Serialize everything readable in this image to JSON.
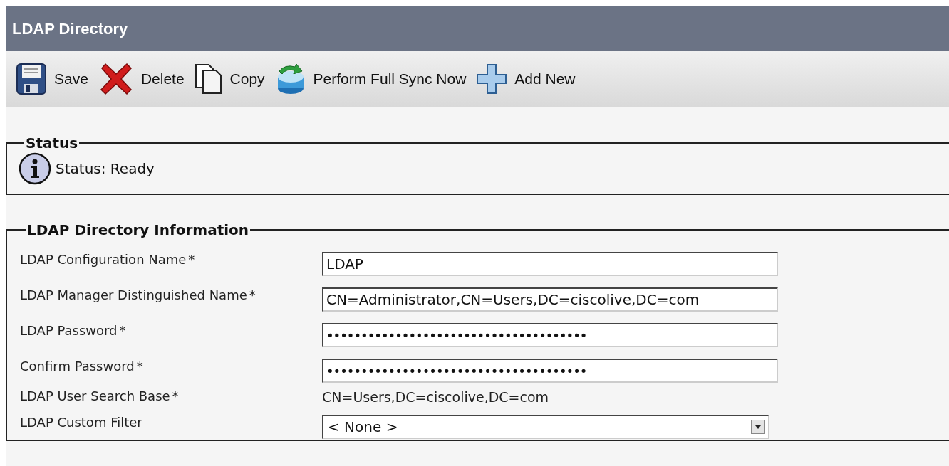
{
  "window": {
    "title": "LDAP Directory"
  },
  "toolbar": [
    {
      "kind": "save",
      "label": "Save"
    },
    {
      "kind": "delete",
      "label": "Delete"
    },
    {
      "kind": "copy",
      "label": "Copy"
    },
    {
      "kind": "sync",
      "label": "Perform Full Sync Now"
    },
    {
      "kind": "add",
      "label": "Add New"
    }
  ],
  "status": {
    "legend": "Status",
    "message": "Status: Ready"
  },
  "info": {
    "legend": "LDAP Directory Information",
    "fields": [
      {
        "kind": "text",
        "label": "LDAP Configuration Name",
        "required_mark": "*",
        "value": "LDAP"
      },
      {
        "kind": "text",
        "label": "LDAP Manager Distinguished Name",
        "required_mark": "*",
        "value": "CN=Administrator,CN=Users,DC=ciscolive,DC=com"
      },
      {
        "kind": "password",
        "label": "LDAP Password",
        "required_mark": "*",
        "value": "••••••••••••••••••••••••••••••••••••••"
      },
      {
        "kind": "password",
        "label": "Confirm Password",
        "required_mark": "*",
        "value": "••••••••••••••••••••••••••••••••••••••"
      },
      {
        "kind": "static",
        "label": "LDAP User Search Base",
        "required_mark": "*",
        "value": "CN=Users,DC=ciscolive,DC=com"
      },
      {
        "kind": "select",
        "label": "LDAP Custom Filter",
        "value": "< None >"
      }
    ]
  }
}
